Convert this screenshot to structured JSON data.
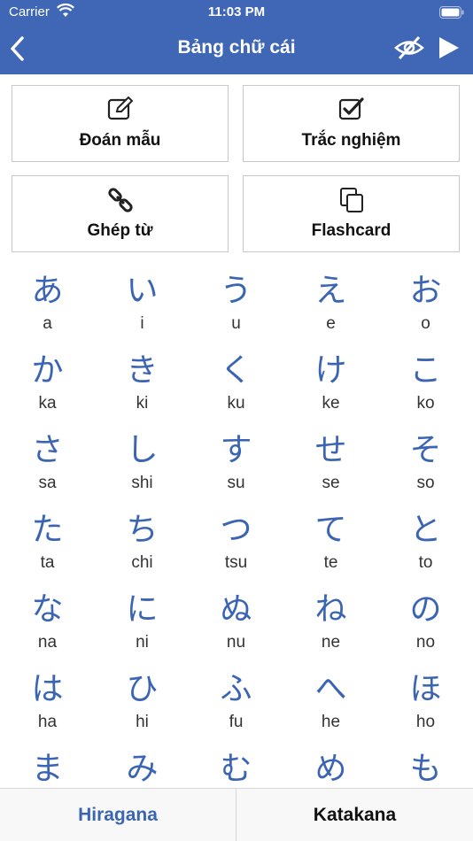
{
  "status_bar": {
    "carrier": "Carrier",
    "time": "11:03 PM"
  },
  "nav": {
    "title": "Bảng chữ cái"
  },
  "modes": [
    {
      "label": "Đoán mẫu",
      "icon": "edit-icon"
    },
    {
      "label": "Trắc nghiệm",
      "icon": "checkbox-icon"
    },
    {
      "label": "Ghép từ",
      "icon": "link-icon"
    },
    {
      "label": "Flashcard",
      "icon": "copy-icon"
    }
  ],
  "kana_rows": [
    [
      {
        "kana": "あ",
        "romaji": "a"
      },
      {
        "kana": "い",
        "romaji": "i"
      },
      {
        "kana": "う",
        "romaji": "u"
      },
      {
        "kana": "え",
        "romaji": "e"
      },
      {
        "kana": "お",
        "romaji": "o"
      }
    ],
    [
      {
        "kana": "か",
        "romaji": "ka"
      },
      {
        "kana": "き",
        "romaji": "ki"
      },
      {
        "kana": "く",
        "romaji": "ku"
      },
      {
        "kana": "け",
        "romaji": "ke"
      },
      {
        "kana": "こ",
        "romaji": "ko"
      }
    ],
    [
      {
        "kana": "さ",
        "romaji": "sa"
      },
      {
        "kana": "し",
        "romaji": "shi"
      },
      {
        "kana": "す",
        "romaji": "su"
      },
      {
        "kana": "せ",
        "romaji": "se"
      },
      {
        "kana": "そ",
        "romaji": "so"
      }
    ],
    [
      {
        "kana": "た",
        "romaji": "ta"
      },
      {
        "kana": "ち",
        "romaji": "chi"
      },
      {
        "kana": "つ",
        "romaji": "tsu"
      },
      {
        "kana": "て",
        "romaji": "te"
      },
      {
        "kana": "と",
        "romaji": "to"
      }
    ],
    [
      {
        "kana": "な",
        "romaji": "na"
      },
      {
        "kana": "に",
        "romaji": "ni"
      },
      {
        "kana": "ぬ",
        "romaji": "nu"
      },
      {
        "kana": "ね",
        "romaji": "ne"
      },
      {
        "kana": "の",
        "romaji": "no"
      }
    ],
    [
      {
        "kana": "は",
        "romaji": "ha"
      },
      {
        "kana": "ひ",
        "romaji": "hi"
      },
      {
        "kana": "ふ",
        "romaji": "fu"
      },
      {
        "kana": "へ",
        "romaji": "he"
      },
      {
        "kana": "ほ",
        "romaji": "ho"
      }
    ],
    [
      {
        "kana": "ま",
        "romaji": ""
      },
      {
        "kana": "み",
        "romaji": ""
      },
      {
        "kana": "む",
        "romaji": ""
      },
      {
        "kana": "め",
        "romaji": ""
      },
      {
        "kana": "も",
        "romaji": ""
      }
    ]
  ],
  "tabs": {
    "hiragana": "Hiragana",
    "katakana": "Katakana"
  },
  "colors": {
    "header": "#3f67b5",
    "kana": "#3b65b3",
    "active_tab": "#3b65b3"
  }
}
